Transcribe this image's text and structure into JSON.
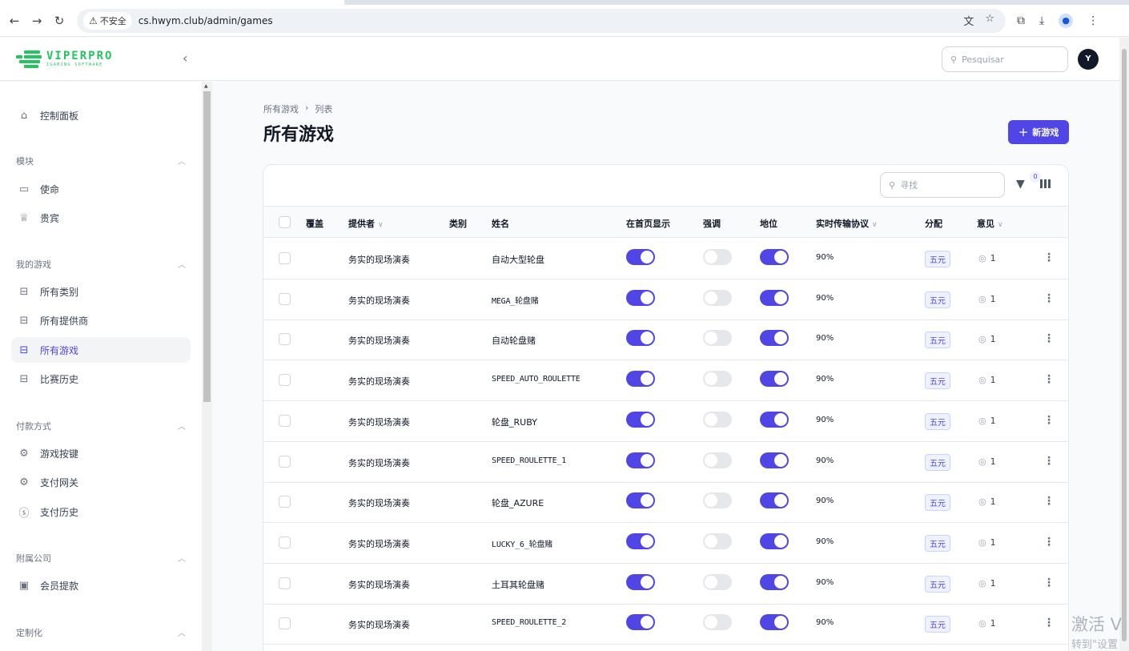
{
  "browser": {
    "insecure_label": "不安全",
    "url": "cs.hwym.club/admin/games"
  },
  "header": {
    "logo_name": "VIPERPRO",
    "logo_sub": "IGAMING SOFTWARE",
    "search_placeholder": "Pesquisar",
    "avatar_initial": "Y",
    "brand_color": "#22c55e",
    "accent_color": "#4f46e5"
  },
  "sidebar": {
    "dashboard": "控制面板",
    "groups": [
      {
        "title": "模块",
        "items": [
          "使命",
          "贵宾"
        ]
      },
      {
        "title": "我的游戏",
        "items": [
          "所有类别",
          "所有提供商",
          "所有游戏",
          "比赛历史"
        ]
      },
      {
        "title": "付款方式",
        "items": [
          "游戏按键",
          "支付网关",
          "支付历史"
        ]
      },
      {
        "title": "附属公司",
        "items": [
          "会员提款"
        ]
      },
      {
        "title": "定制化",
        "items": []
      }
    ],
    "active_item": "所有游戏"
  },
  "main": {
    "breadcrumb": [
      "所有游戏",
      "列表"
    ],
    "title": "所有游戏",
    "new_button": "新游戏",
    "table_search_placeholder": "寻找",
    "filter_count": "0",
    "columns": [
      "覆盖",
      "提供者",
      "类别",
      "姓名",
      "在首页显示",
      "强调",
      "地位",
      "实时传输协议",
      "分配",
      "意见"
    ],
    "rows": [
      {
        "provider": "务实的现场演奏",
        "name": "自动大型轮盘",
        "show_home": true,
        "highlight": false,
        "status": true,
        "rtp": "90%",
        "distribution": "五元",
        "views": "1"
      },
      {
        "provider": "务实的现场演奏",
        "name": "MEGA_轮盘赌",
        "show_home": true,
        "highlight": false,
        "status": true,
        "rtp": "90%",
        "distribution": "五元",
        "views": "1"
      },
      {
        "provider": "务实的现场演奏",
        "name": "自动轮盘赌",
        "show_home": true,
        "highlight": false,
        "status": true,
        "rtp": "90%",
        "distribution": "五元",
        "views": "1"
      },
      {
        "provider": "务实的现场演奏",
        "name": "SPEED_AUTO_ROULETTE",
        "show_home": true,
        "highlight": false,
        "status": true,
        "rtp": "90%",
        "distribution": "五元",
        "views": "1"
      },
      {
        "provider": "务实的现场演奏",
        "name": "轮盘_RUBY",
        "show_home": true,
        "highlight": false,
        "status": true,
        "rtp": "90%",
        "distribution": "五元",
        "views": "1"
      },
      {
        "provider": "务实的现场演奏",
        "name": "SPEED_ROULETTE_1",
        "show_home": true,
        "highlight": false,
        "status": true,
        "rtp": "90%",
        "distribution": "五元",
        "views": "1"
      },
      {
        "provider": "务实的现场演奏",
        "name": "轮盘_AZURE",
        "show_home": true,
        "highlight": false,
        "status": true,
        "rtp": "90%",
        "distribution": "五元",
        "views": "1"
      },
      {
        "provider": "务实的现场演奏",
        "name": "LUCKY_6_轮盘赌",
        "show_home": true,
        "highlight": false,
        "status": true,
        "rtp": "90%",
        "distribution": "五元",
        "views": "1"
      },
      {
        "provider": "务实的现场演奏",
        "name": "土耳其轮盘赌",
        "show_home": true,
        "highlight": false,
        "status": true,
        "rtp": "90%",
        "distribution": "五元",
        "views": "1"
      },
      {
        "provider": "务实的现场演奏",
        "name": "SPEED_ROULETTE_2",
        "show_home": true,
        "highlight": false,
        "status": true,
        "rtp": "90%",
        "distribution": "五元",
        "views": "1"
      }
    ]
  },
  "watermark": {
    "line1": "激活 V",
    "line2": "转到\"设置"
  }
}
